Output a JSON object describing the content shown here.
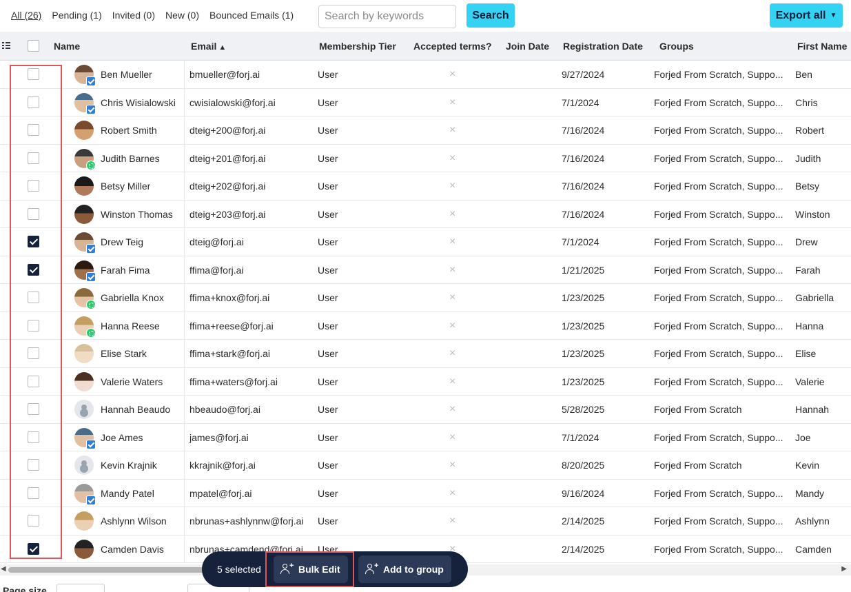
{
  "filters": [
    {
      "label": "All (26)",
      "active": true
    },
    {
      "label": "Pending (1)",
      "active": false
    },
    {
      "label": "Invited (0)",
      "active": false
    },
    {
      "label": "New (0)",
      "active": false
    },
    {
      "label": "Bounced Emails (1)",
      "active": false
    }
  ],
  "search": {
    "placeholder": "Search by keywords",
    "button_label": "Search"
  },
  "export": {
    "label": "Export all",
    "icon": "chevron-down-icon"
  },
  "columns": {
    "name": "Name",
    "email": "Email",
    "tier": "Membership Tier",
    "terms": "Accepted terms?",
    "join": "Join Date",
    "registration": "Registration Date",
    "groups": "Groups",
    "first_name": "First Name"
  },
  "rows": [
    {
      "name": "Ben Mueller",
      "email": "bmueller@forj.ai",
      "tier": "User",
      "terms": "×",
      "join": "",
      "registration": "9/27/2024",
      "groups": "Forjed From Scratch,  Suppo...",
      "first_name": "Ben",
      "checked": false,
      "badge": "verified"
    },
    {
      "name": "Chris Wisialowski",
      "email": "cwisialowski@forj.ai",
      "tier": "User",
      "terms": "×",
      "join": "",
      "registration": "7/1/2024",
      "groups": "Forjed From Scratch,  Suppo...",
      "first_name": "Chris",
      "checked": false,
      "badge": "verified"
    },
    {
      "name": "Robert Smith",
      "email": "dteig+200@forj.ai",
      "tier": "User",
      "terms": "×",
      "join": "",
      "registration": "7/16/2024",
      "groups": "Forjed From Scratch,  Suppo...",
      "first_name": "Robert",
      "checked": false,
      "badge": "none"
    },
    {
      "name": "Judith Barnes",
      "email": "dteig+201@forj.ai",
      "tier": "User",
      "terms": "×",
      "join": "",
      "registration": "7/16/2024",
      "groups": "Forjed From Scratch,  Suppo...",
      "first_name": "Judith",
      "checked": false,
      "badge": "pending"
    },
    {
      "name": "Betsy Miller",
      "email": "dteig+202@forj.ai",
      "tier": "User",
      "terms": "×",
      "join": "",
      "registration": "7/16/2024",
      "groups": "Forjed From Scratch,  Suppo...",
      "first_name": "Betsy",
      "checked": false,
      "badge": "none"
    },
    {
      "name": "Winston Thomas",
      "email": "dteig+203@forj.ai",
      "tier": "User",
      "terms": "×",
      "join": "",
      "registration": "7/16/2024",
      "groups": "Forjed From Scratch,  Suppo...",
      "first_name": "Winston",
      "checked": false,
      "badge": "none"
    },
    {
      "name": "Drew Teig",
      "email": "dteig@forj.ai",
      "tier": "User",
      "terms": "×",
      "join": "",
      "registration": "7/1/2024",
      "groups": "Forjed From Scratch,  Suppo...",
      "first_name": "Drew",
      "checked": true,
      "badge": "verified"
    },
    {
      "name": "Farah Fima",
      "email": "ffima@forj.ai",
      "tier": "User",
      "terms": "×",
      "join": "",
      "registration": "1/21/2025",
      "groups": "Forjed From Scratch,  Suppo...",
      "first_name": "Farah",
      "checked": true,
      "badge": "verified"
    },
    {
      "name": "Gabriella Knox",
      "email": "ffima+knox@forj.ai",
      "tier": "User",
      "terms": "×",
      "join": "",
      "registration": "1/23/2025",
      "groups": "Forjed From Scratch,  Suppo...",
      "first_name": "Gabriella",
      "checked": false,
      "badge": "pending"
    },
    {
      "name": "Hanna Reese",
      "email": "ffima+reese@forj.ai",
      "tier": "User",
      "terms": "×",
      "join": "",
      "registration": "1/23/2025",
      "groups": "Forjed From Scratch,  Suppo...",
      "first_name": "Hanna",
      "checked": false,
      "badge": "pending"
    },
    {
      "name": "Elise Stark",
      "email": "ffima+stark@forj.ai",
      "tier": "User",
      "terms": "×",
      "join": "",
      "registration": "1/23/2025",
      "groups": "Forjed From Scratch,  Suppo...",
      "first_name": "Elise",
      "checked": false,
      "badge": "none"
    },
    {
      "name": "Valerie Waters",
      "email": "ffima+waters@forj.ai",
      "tier": "User",
      "terms": "×",
      "join": "",
      "registration": "1/23/2025",
      "groups": "Forjed From Scratch,  Suppo...",
      "first_name": "Valerie",
      "checked": false,
      "badge": "none"
    },
    {
      "name": "Hannah Beaudo",
      "email": "hbeaudo@forj.ai",
      "tier": "User",
      "terms": "×",
      "join": "",
      "registration": "5/28/2025",
      "groups": "Forjed From Scratch",
      "first_name": "Hannah",
      "checked": false,
      "badge": "none"
    },
    {
      "name": "Joe Ames",
      "email": "james@forj.ai",
      "tier": "User",
      "terms": "×",
      "join": "",
      "registration": "7/1/2024",
      "groups": "Forjed From Scratch,  Suppo...",
      "first_name": "Joe",
      "checked": false,
      "badge": "verified"
    },
    {
      "name": "Kevin Krajnik",
      "email": "kkrajnik@forj.ai",
      "tier": "User",
      "terms": "×",
      "join": "",
      "registration": "8/20/2025",
      "groups": "Forjed From Scratch",
      "first_name": "Kevin",
      "checked": false,
      "badge": "none"
    },
    {
      "name": "Mandy Patel",
      "email": "mpatel@forj.ai",
      "tier": "User",
      "terms": "×",
      "join": "",
      "registration": "9/16/2024",
      "groups": "Forjed From Scratch,  Suppo...",
      "first_name": "Mandy",
      "checked": false,
      "badge": "verified"
    },
    {
      "name": "Ashlynn Wilson",
      "email": "nbrunas+ashlynnw@forj.ai",
      "tier": "User",
      "terms": "×",
      "join": "",
      "registration": "2/14/2025",
      "groups": "Forjed From Scratch,  Suppo...",
      "first_name": "Ashlynn",
      "checked": false,
      "badge": "none"
    },
    {
      "name": "Camden Davis",
      "email": "nbrunas+camdend@forj.ai",
      "tier": "User",
      "terms": "×",
      "join": "",
      "registration": "2/14/2025",
      "groups": "Forjed From Scratch,  Suppo...",
      "first_name": "Camden",
      "checked": true,
      "badge": "none"
    }
  ],
  "selection_bar": {
    "count_label": "5 selected",
    "bulk_edit_label": "Bulk Edit",
    "add_to_group_label": "Add to group"
  },
  "footer": {
    "page_size_label": "Page size"
  },
  "colors": {
    "accent": "#35d3f3",
    "dark": "#16213b",
    "highlight": "#e0555a"
  }
}
